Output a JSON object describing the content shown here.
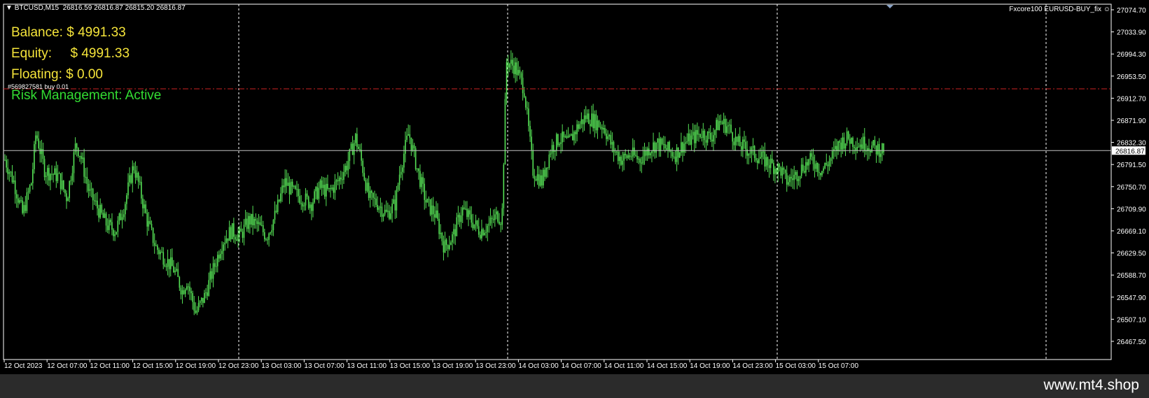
{
  "header": {
    "symbol_line": "BTCUSD,M15  26816.59 26816.87 26815.20 26816.87",
    "ea_name": "Fxcore100 EURUSD-BUY_fix"
  },
  "account": {
    "balance": "Balance: $ 4991.33",
    "equity": "Equity:     $ 4991.33",
    "floating": "Floating: $ 0.00",
    "risk": "Risk Management: Active"
  },
  "order_label": "#569827581 buy 0.01",
  "current_price": "26816.87",
  "watermark": "www.mt4.shop",
  "colors": {
    "candle": "#55e055",
    "text_yellow": "#f5e43a",
    "text_green": "#33dd33",
    "order_line": "#cc2222"
  },
  "chart_data": {
    "type": "candlestick",
    "y_ticks": [
      "27074.70",
      "27033.90",
      "26994.30",
      "26953.50",
      "26912.70",
      "26871.90",
      "26832.30",
      "26791.50",
      "26750.70",
      "26709.90",
      "26669.10",
      "26629.50",
      "26588.70",
      "26547.90",
      "26507.10",
      "26467.50"
    ],
    "x_ticks": [
      "12 Oct 2023",
      "12 Oct 07:00",
      "12 Oct 11:00",
      "12 Oct 15:00",
      "12 Oct 19:00",
      "12 Oct 23:00",
      "13 Oct 03:00",
      "13 Oct 07:00",
      "13 Oct 11:00",
      "13 Oct 15:00",
      "13 Oct 19:00",
      "13 Oct 23:00",
      "14 Oct 03:00",
      "14 Oct 07:00",
      "14 Oct 11:00",
      "14 Oct 15:00",
      "14 Oct 19:00",
      "14 Oct 23:00",
      "15 Oct 03:00",
      "15 Oct 07:00"
    ],
    "ylim": [
      26467.5,
      27074.7
    ],
    "order_price": 26930,
    "bid": 26816.87,
    "close_path": [
      [
        0,
        26800
      ],
      [
        2,
        26760
      ],
      [
        4,
        26700
      ],
      [
        6,
        26760
      ],
      [
        7,
        26850
      ],
      [
        9,
        26780
      ],
      [
        12,
        26770
      ],
      [
        14,
        26730
      ],
      [
        16,
        26830
      ],
      [
        17,
        26810
      ],
      [
        19,
        26740
      ],
      [
        21,
        26710
      ],
      [
        23,
        26680
      ],
      [
        25,
        26670
      ],
      [
        27,
        26720
      ],
      [
        29,
        26790
      ],
      [
        30,
        26760
      ],
      [
        32,
        26690
      ],
      [
        34,
        26640
      ],
      [
        36,
        26620
      ],
      [
        38,
        26600
      ],
      [
        40,
        26560
      ],
      [
        41,
        26580
      ],
      [
        43,
        26520
      ],
      [
        45,
        26550
      ],
      [
        47,
        26600
      ],
      [
        49,
        26650
      ],
      [
        51,
        26670
      ],
      [
        53,
        26660
      ],
      [
        55,
        26690
      ],
      [
        57,
        26680
      ],
      [
        59,
        26660
      ],
      [
        61,
        26700
      ],
      [
        63,
        26760
      ],
      [
        65,
        26740
      ],
      [
        67,
        26730
      ],
      [
        69,
        26720
      ],
      [
        71,
        26750
      ],
      [
        73,
        26740
      ],
      [
        75,
        26760
      ],
      [
        77,
        26790
      ],
      [
        79,
        26840
      ],
      [
        80,
        26810
      ],
      [
        82,
        26730
      ],
      [
        84,
        26720
      ],
      [
        86,
        26700
      ],
      [
        88,
        26720
      ],
      [
        89,
        26780
      ],
      [
        91,
        26850
      ],
      [
        93,
        26780
      ],
      [
        95,
        26720
      ],
      [
        97,
        26700
      ],
      [
        99,
        26640
      ],
      [
        101,
        26660
      ],
      [
        103,
        26710
      ],
      [
        105,
        26690
      ],
      [
        107,
        26670
      ],
      [
        109,
        26680
      ],
      [
        111,
        26700
      ],
      [
        112,
        26690
      ],
      [
        113,
        26980
      ],
      [
        115,
        26970
      ],
      [
        117,
        26930
      ],
      [
        119,
        26780
      ],
      [
        121,
        26760
      ],
      [
        123,
        26820
      ],
      [
        125,
        26840
      ],
      [
        127,
        26830
      ],
      [
        129,
        26860
      ],
      [
        131,
        26880
      ],
      [
        133,
        26870
      ],
      [
        135,
        26860
      ],
      [
        137,
        26820
      ],
      [
        139,
        26800
      ],
      [
        141,
        26810
      ],
      [
        143,
        26800
      ],
      [
        145,
        26820
      ],
      [
        147,
        26830
      ],
      [
        149,
        26820
      ],
      [
        151,
        26810
      ],
      [
        153,
        26830
      ],
      [
        155,
        26840
      ],
      [
        157,
        26850
      ],
      [
        159,
        26840
      ],
      [
        161,
        26870
      ],
      [
        163,
        26860
      ],
      [
        165,
        26830
      ],
      [
        167,
        26820
      ],
      [
        169,
        26810
      ],
      [
        171,
        26800
      ],
      [
        173,
        26790
      ],
      [
        175,
        26780
      ],
      [
        176,
        26760
      ],
      [
        178,
        26770
      ],
      [
        180,
        26790
      ],
      [
        182,
        26800
      ],
      [
        184,
        26780
      ],
      [
        186,
        26800
      ],
      [
        188,
        26830
      ],
      [
        190,
        26840
      ],
      [
        192,
        26830
      ],
      [
        194,
        26830
      ],
      [
        196,
        26820
      ],
      [
        198,
        26820
      ]
    ]
  }
}
